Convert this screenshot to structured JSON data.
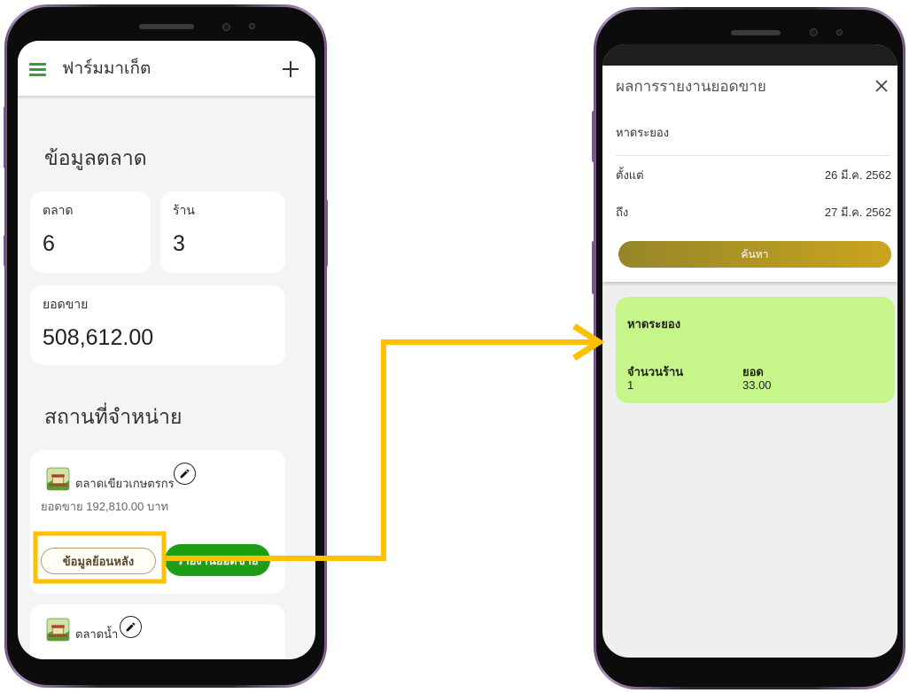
{
  "left_phone": {
    "app_title": "ฟาร์มมาเก็ต",
    "section_market_info": "ข้อมูลตลาด",
    "stats": {
      "market_label": "ตลาด",
      "market_value": "6",
      "shop_label": "ร้าน",
      "shop_value": "3",
      "sales_label": "ยอดขาย",
      "sales_value": "508,612.00"
    },
    "section_locations": "สถานที่จำหน่าย",
    "locations": [
      {
        "name": "ตลาดเขียวเกษตรกร",
        "sales": "ยอดขาย 192,810.00 บาท",
        "history_button": "ข้อมูลย้อนหลัง",
        "report_button": "รายงานยอดขาย"
      },
      {
        "name": "ตลาดน้ำ"
      }
    ]
  },
  "right_phone": {
    "title": "ผลการรายงานยอดขาย",
    "location": "หาดระยอง",
    "from_label": "ตั้งแต่",
    "from_value": "26 มี.ค. 2562",
    "to_label": "ถึง",
    "to_value": "27 มี.ค. 2562",
    "search_button": "ค้นหา",
    "result": {
      "name": "หาดระยอง",
      "shops_label": "จำนวนร้าน",
      "shops_value": "1",
      "total_label": "ยอด",
      "total_value": "33.00"
    }
  },
  "icons": {
    "menu": "hamburger-icon",
    "add": "plus-icon",
    "edit": "pencil-icon",
    "market": "market-icon",
    "close": "close-icon",
    "flow": "arrow-icon"
  },
  "colors": {
    "brand_green": "#1e9e14",
    "menu_green": "#3b9b3b",
    "highlight_yellow": "#ffc000",
    "result_card": "#c6f68a",
    "search_button_start": "#958629",
    "search_button_end": "#c9a51f"
  }
}
